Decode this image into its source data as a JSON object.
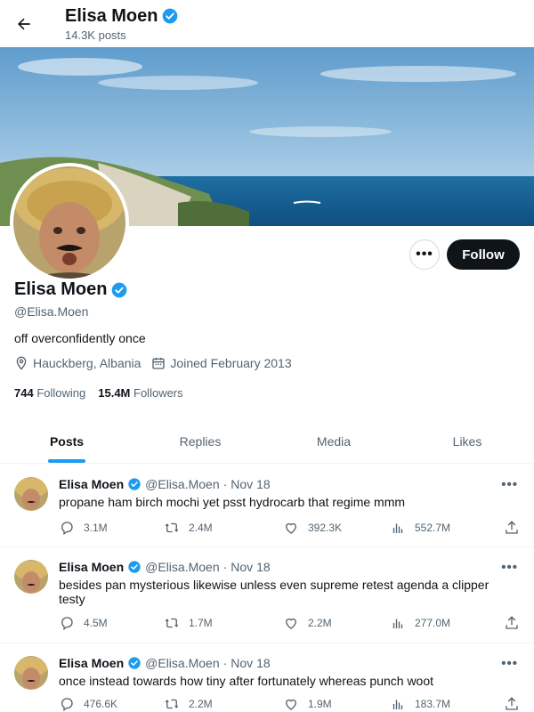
{
  "header": {
    "name": "Elisa Moen",
    "post_count": "14.3K posts"
  },
  "profile": {
    "name": "Elisa Moen",
    "handle": "@Elisa.Moen",
    "bio": "off overconfidently once",
    "location": "Hauckberg, Albania",
    "joined": "Joined February 2013",
    "following_count": "744",
    "following_label": "Following",
    "followers_count": "15.4M",
    "followers_label": "Followers",
    "follow_label": "Follow",
    "more_label": "•••"
  },
  "tabs": [
    {
      "label": "Posts",
      "active": true
    },
    {
      "label": "Replies",
      "active": false
    },
    {
      "label": "Media",
      "active": false
    },
    {
      "label": "Likes",
      "active": false
    }
  ],
  "posts": [
    {
      "name": "Elisa Moen",
      "handle": "@Elisa.Moen",
      "sep": "·",
      "date": "Nov 18",
      "text": "propane ham birch mochi yet psst hydrocarb that regime mmm",
      "replies": "3.1M",
      "reposts": "2.4M",
      "likes": "392.3K",
      "views": "552.7M",
      "more": "•••"
    },
    {
      "name": "Elisa Moen",
      "handle": "@Elisa.Moen",
      "sep": "·",
      "date": "Nov 18",
      "text": "besides pan mysterious likewise unless even supreme retest agenda a clipper testy",
      "replies": "4.5M",
      "reposts": "1.7M",
      "likes": "2.2M",
      "views": "277.0M",
      "more": "•••"
    },
    {
      "name": "Elisa Moen",
      "handle": "@Elisa.Moen",
      "sep": "·",
      "date": "Nov 18",
      "text": "once instead towards how tiny after fortunately whereas punch woot",
      "replies": "476.6K",
      "reposts": "2.2M",
      "likes": "1.9M",
      "views": "183.7M",
      "more": "•••"
    }
  ],
  "colors": {
    "accent": "#1d9bf0",
    "text": "#0f1419",
    "muted": "#536471",
    "border": "#eff3f4"
  },
  "icons": [
    "back-arrow-icon",
    "verified-badge-icon",
    "location-icon",
    "calendar-icon",
    "reply-icon",
    "repost-icon",
    "like-icon",
    "views-icon",
    "share-icon"
  ]
}
